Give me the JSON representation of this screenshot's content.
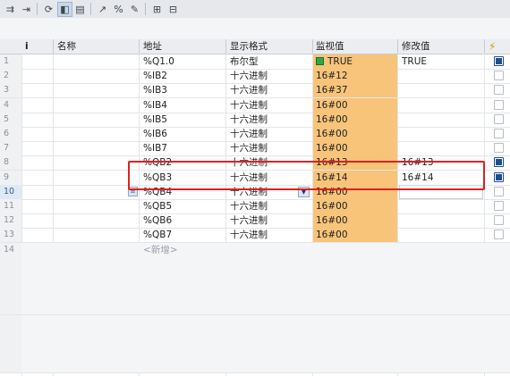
{
  "toolbar": {
    "buttons": [
      "modify-all-icon",
      "modify-once-icon",
      "monitor-all-icon",
      "monitor-once-icon",
      "display-format-icon",
      "modify-now-icon",
      "modify-trigger-icon",
      "enable-peripheral-icon",
      "show-hide-columns-icon",
      "show-extended-icon"
    ]
  },
  "columns": {
    "info": "i",
    "name": "名称",
    "address": "地址",
    "format": "显示格式",
    "monitor": "监视值",
    "modify": "修改值",
    "force_icon": "lightning-icon"
  },
  "rows": [
    {
      "n": "1",
      "address": "%Q1.0",
      "format": "布尔型",
      "monitor": "TRUE",
      "modify": "TRUE",
      "checked": true
    },
    {
      "n": "2",
      "address": "%IB2",
      "format": "十六进制",
      "monitor": "16#12",
      "modify": "",
      "checked": false
    },
    {
      "n": "3",
      "address": "%IB3",
      "format": "十六进制",
      "monitor": "16#37",
      "modify": "",
      "checked": false
    },
    {
      "n": "4",
      "address": "%IB4",
      "format": "十六进制",
      "monitor": "16#00",
      "modify": "",
      "checked": false
    },
    {
      "n": "5",
      "address": "%IB5",
      "format": "十六进制",
      "monitor": "16#00",
      "modify": "",
      "checked": false
    },
    {
      "n": "6",
      "address": "%IB6",
      "format": "十六进制",
      "monitor": "16#00",
      "modify": "",
      "checked": false
    },
    {
      "n": "7",
      "address": "%IB7",
      "format": "十六进制",
      "monitor": "16#00",
      "modify": "",
      "checked": false
    },
    {
      "n": "8",
      "address": "%QB2",
      "format": "十六进制",
      "monitor": "16#13",
      "modify": "16#13",
      "checked": true
    },
    {
      "n": "9",
      "address": "%QB3",
      "format": "十六进制",
      "monitor": "16#14",
      "modify": "16#14",
      "checked": true
    },
    {
      "n": "10",
      "address": "%QB4",
      "format": "十六进制",
      "monitor": "16#00",
      "modify": "",
      "checked": false
    },
    {
      "n": "11",
      "address": "%QB5",
      "format": "十六进制",
      "monitor": "16#00",
      "modify": "",
      "checked": false
    },
    {
      "n": "12",
      "address": "%QB6",
      "format": "十六进制",
      "monitor": "16#00",
      "modify": "",
      "checked": false
    },
    {
      "n": "13",
      "address": "%QB7",
      "format": "十六进制",
      "monitor": "16#00",
      "modify": "",
      "checked": false
    },
    {
      "n": "14",
      "address": "<新增>",
      "format": "",
      "monitor": "",
      "modify": "",
      "checked": false
    }
  ],
  "colors": {
    "monitor_bg": "#f7c47a",
    "highlight": "#e02020",
    "checkbox": "#1f4f8a"
  }
}
